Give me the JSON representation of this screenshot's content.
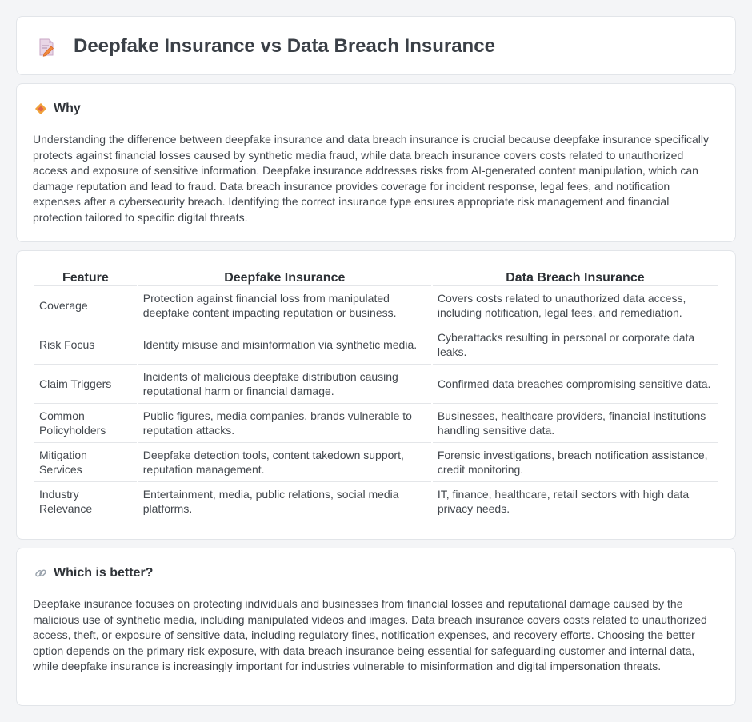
{
  "header": {
    "title": "Deepfake Insurance vs Data Breach Insurance",
    "icon": "document-pen-icon"
  },
  "why": {
    "heading": "Why",
    "icon": "diamond-icon",
    "text": "Understanding the difference between deepfake insurance and data breach insurance is crucial because deepfake insurance specifically protects against financial losses caused by synthetic media fraud, while data breach insurance covers costs related to unauthorized access and exposure of sensitive information. Deepfake insurance addresses risks from AI-generated content manipulation, which can damage reputation and lead to fraud. Data breach insurance provides coverage for incident response, legal fees, and notification expenses after a cybersecurity breach. Identifying the correct insurance type ensures appropriate risk management and financial protection tailored to specific digital threats."
  },
  "table": {
    "headers": [
      "Feature",
      "Deepfake Insurance",
      "Data Breach Insurance"
    ],
    "rows": [
      [
        "Coverage",
        "Protection against financial loss from manipulated deepfake content impacting reputation or business.",
        "Covers costs related to unauthorized data access, including notification, legal fees, and remediation."
      ],
      [
        "Risk Focus",
        "Identity misuse and misinformation via synthetic media.",
        "Cyberattacks resulting in personal or corporate data leaks."
      ],
      [
        "Claim Triggers",
        "Incidents of malicious deepfake distribution causing reputational harm or financial damage.",
        "Confirmed data breaches compromising sensitive data."
      ],
      [
        "Common Policyholders",
        "Public figures, media companies, brands vulnerable to reputation attacks.",
        "Businesses, healthcare providers, financial institutions handling sensitive data."
      ],
      [
        "Mitigation Services",
        "Deepfake detection tools, content takedown support, reputation management.",
        "Forensic investigations, breach notification assistance, credit monitoring."
      ],
      [
        "Industry Relevance",
        "Entertainment, media, public relations, social media platforms.",
        "IT, finance, healthcare, retail sectors with high data privacy needs."
      ]
    ]
  },
  "better": {
    "heading": "Which is better?",
    "icon": "link-icon",
    "text": "Deepfake insurance focuses on protecting individuals and businesses from financial losses and reputational damage caused by the malicious use of synthetic media, including manipulated videos and images. Data breach insurance covers costs related to unauthorized access, theft, or exposure of sensitive data, including regulatory fines, notification expenses, and recovery efforts. Choosing the better option depends on the primary risk exposure, with data breach insurance being essential for safeguarding customer and internal data, while deepfake insurance is increasingly important for industries vulnerable to misinformation and digital impersonation threats."
  },
  "colors": {
    "page_bg": "#f4f5f7",
    "card_bg": "#ffffff",
    "border": "#e2e5e9",
    "accent_orange": "#f0a13b",
    "accent_pink": "#e07a8c"
  }
}
